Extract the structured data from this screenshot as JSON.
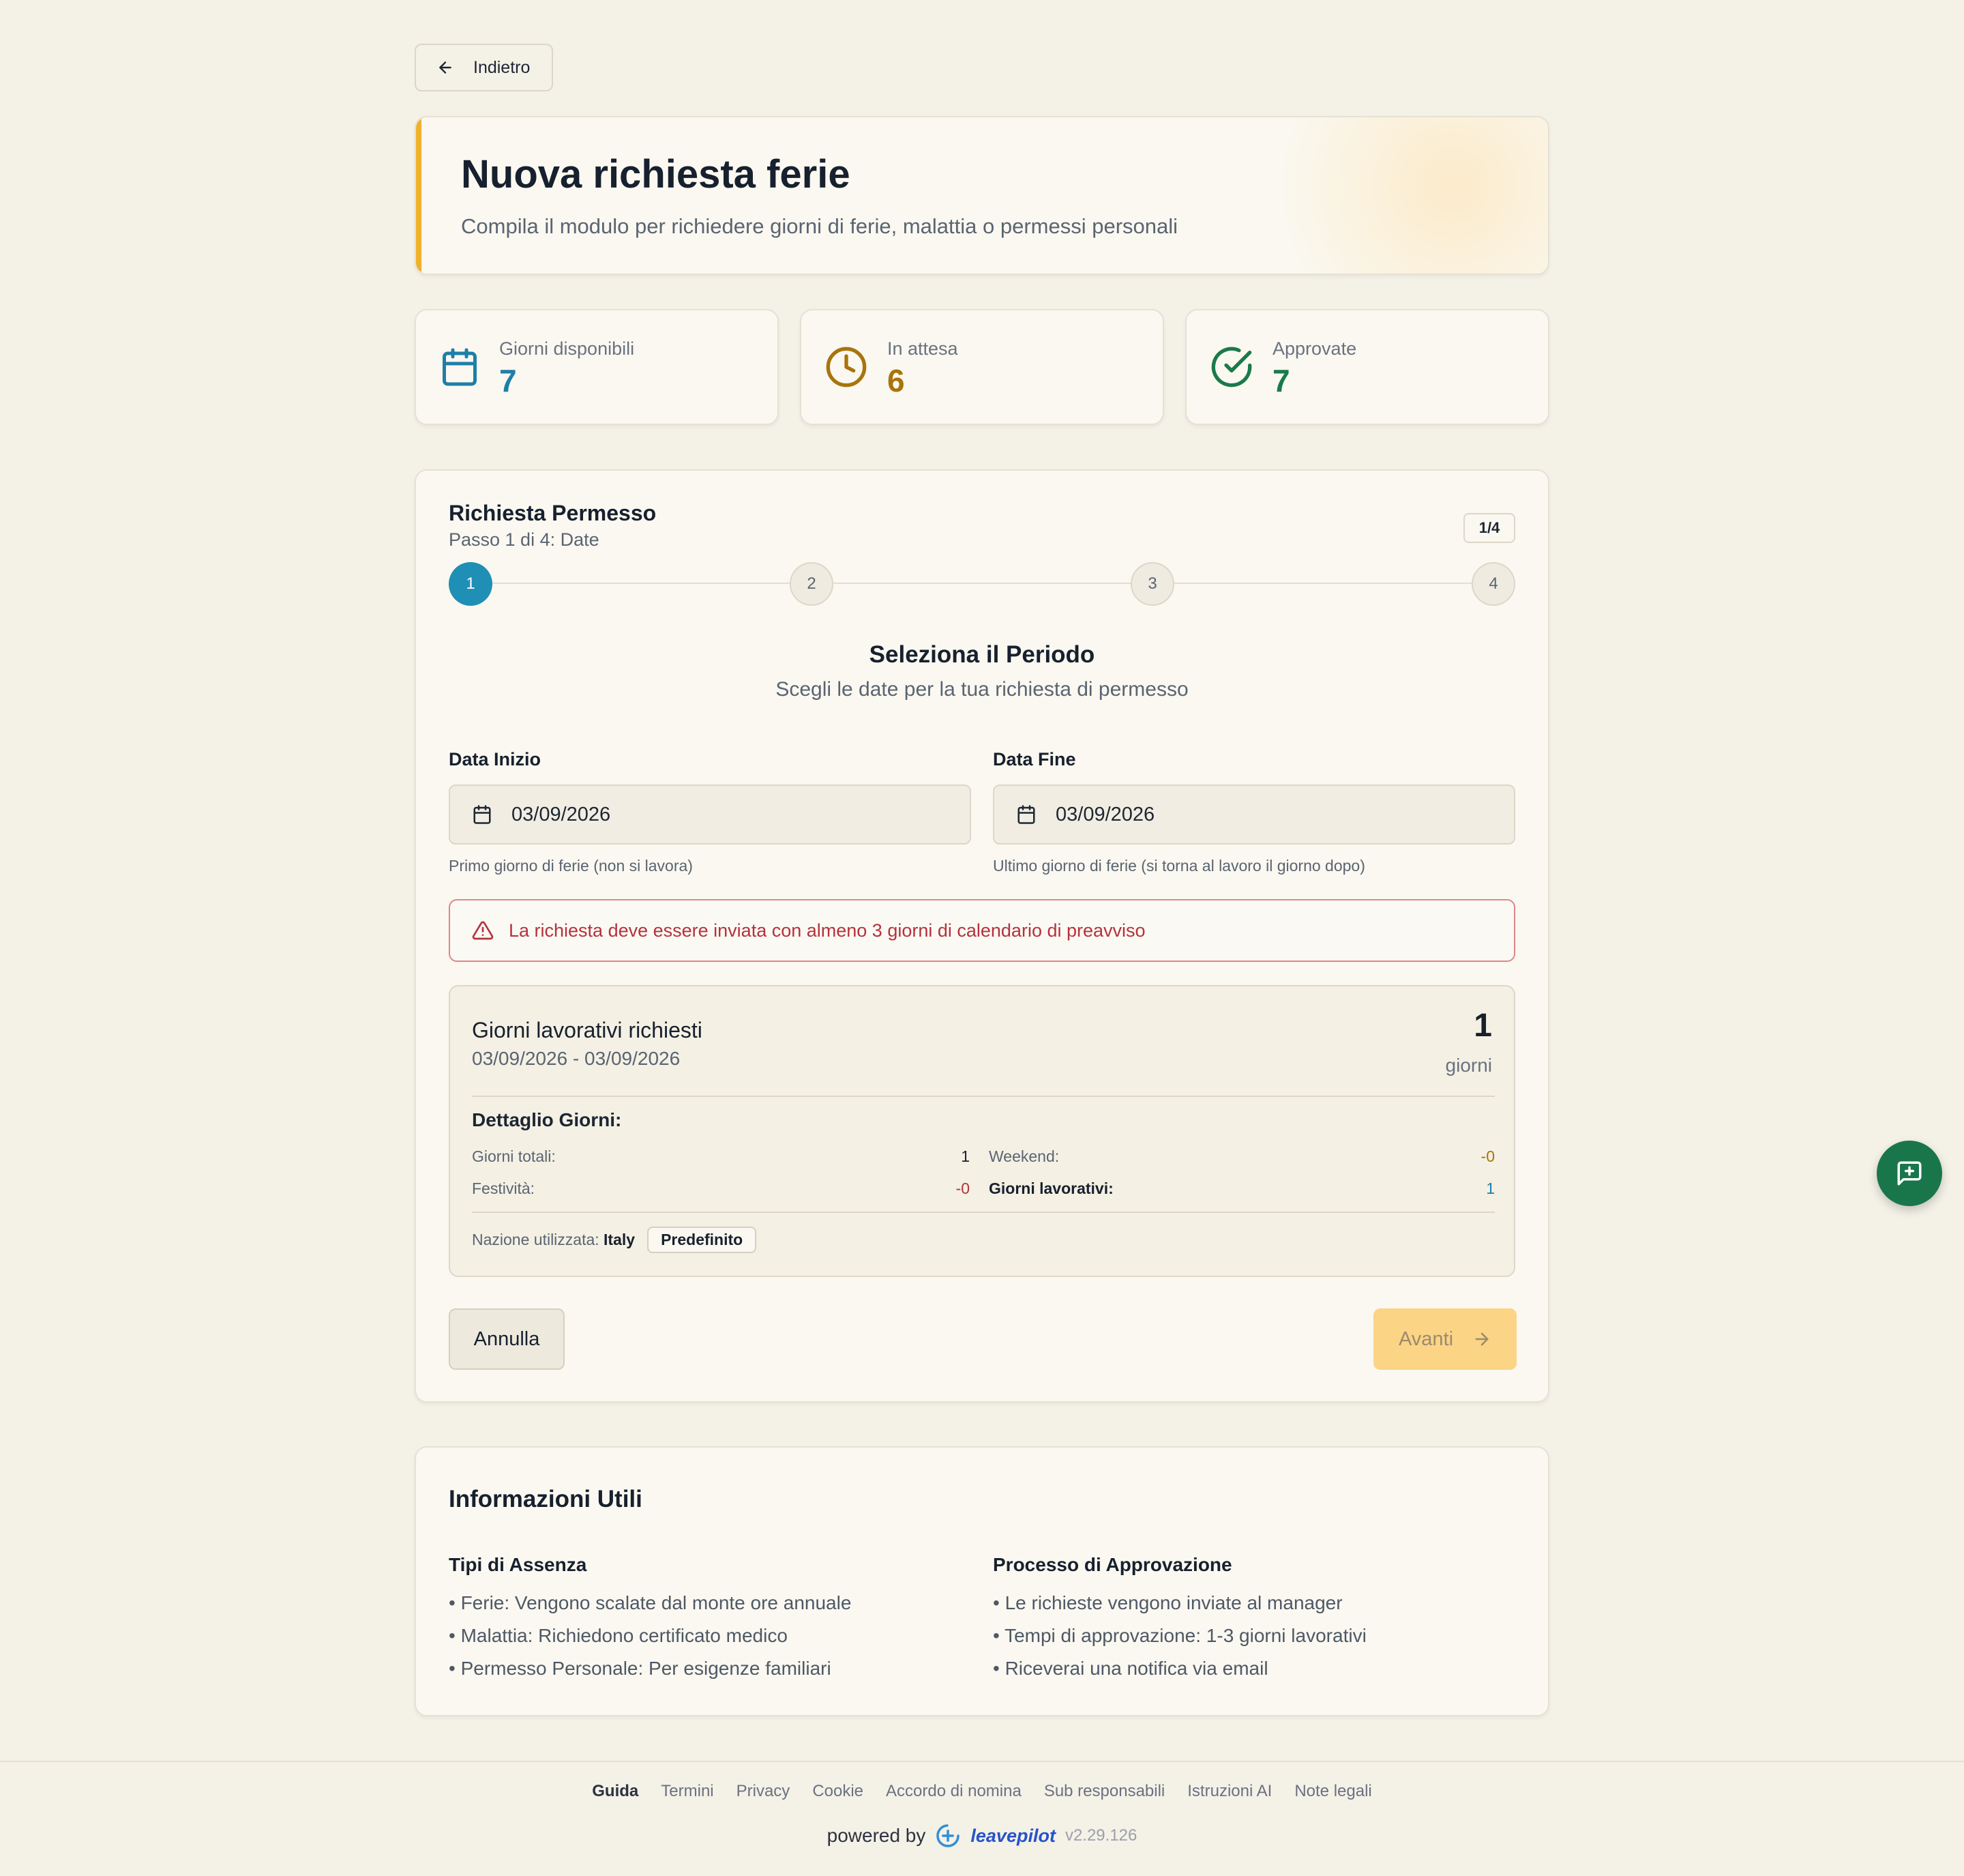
{
  "nav": {
    "back_label": "Indietro"
  },
  "header": {
    "title": "Nuova richiesta ferie",
    "subtitle": "Compila il modulo per richiedere giorni di ferie, malattia o permessi personali"
  },
  "stats": [
    {
      "label": "Giorni disponibili",
      "value": "7",
      "icon": "calendar-icon",
      "color": "#1f7ea8"
    },
    {
      "label": "In attesa",
      "value": "6",
      "icon": "clock-icon",
      "color": "#a8740c"
    },
    {
      "label": "Approvate",
      "value": "7",
      "icon": "check-circle-icon",
      "color": "#1a7a4a"
    }
  ],
  "form": {
    "title": "Richiesta Permesso",
    "subtitle": "Passo 1 di 4: Date",
    "step_badge": "1/4",
    "steps": [
      "1",
      "2",
      "3",
      "4"
    ],
    "current_step": 1,
    "section_title": "Seleziona il Periodo",
    "section_subtitle": "Scegli le date per la tua richiesta di permesso",
    "start": {
      "label": "Data Inizio",
      "value": "03/09/2026",
      "hint": "Primo giorno di ferie (non si lavora)"
    },
    "end": {
      "label": "Data Fine",
      "value": "03/09/2026",
      "hint": "Ultimo giorno di ferie (si torna al lavoro il giorno dopo)"
    },
    "alert": "La richiesta deve essere inviata con almeno 3 giorni di calendario di preavviso",
    "summary": {
      "title": "Giorni lavorativi richiesti",
      "range": "03/09/2026 - 03/09/2026",
      "count": "1",
      "unit": "giorni",
      "detail_title": "Dettaglio Giorni:",
      "total_label": "Giorni totali:",
      "total_value": "1",
      "weekend_label": "Weekend:",
      "weekend_value": "-0",
      "holiday_label": "Festività:",
      "holiday_value": "-0",
      "working_label": "Giorni lavorativi:",
      "working_value": "1",
      "nation_label": "Nazione utilizzata:",
      "nation_value": "Italy",
      "nation_badge": "Predefinito"
    },
    "cancel_label": "Annulla",
    "next_label": "Avanti"
  },
  "info": {
    "title": "Informazioni Utili",
    "absence_title": "Tipi di Assenza",
    "absence_items": [
      "• Ferie: Vengono scalate dal monte ore annuale",
      "• Malattia: Richiedono certificato medico",
      "• Permesso Personale: Per esigenze familiari"
    ],
    "approval_title": "Processo di Approvazione",
    "approval_items": [
      "• Le richieste vengono inviate al manager",
      "• Tempi di approvazione: 1-3 giorni lavorativi",
      "• Riceverai una notifica via email"
    ]
  },
  "footer": {
    "links": [
      "Guida",
      "Termini",
      "Privacy",
      "Cookie",
      "Accordo di nomina",
      "Sub responsabili",
      "Istruzioni AI",
      "Note legali"
    ],
    "powered_by": "powered by",
    "brand": "leavepilot",
    "version": "v2.29.126"
  },
  "colors": {
    "accent": "#f2b12a",
    "primary": "#1f8fb5",
    "danger": "#b4323c",
    "fab": "#19764a"
  }
}
